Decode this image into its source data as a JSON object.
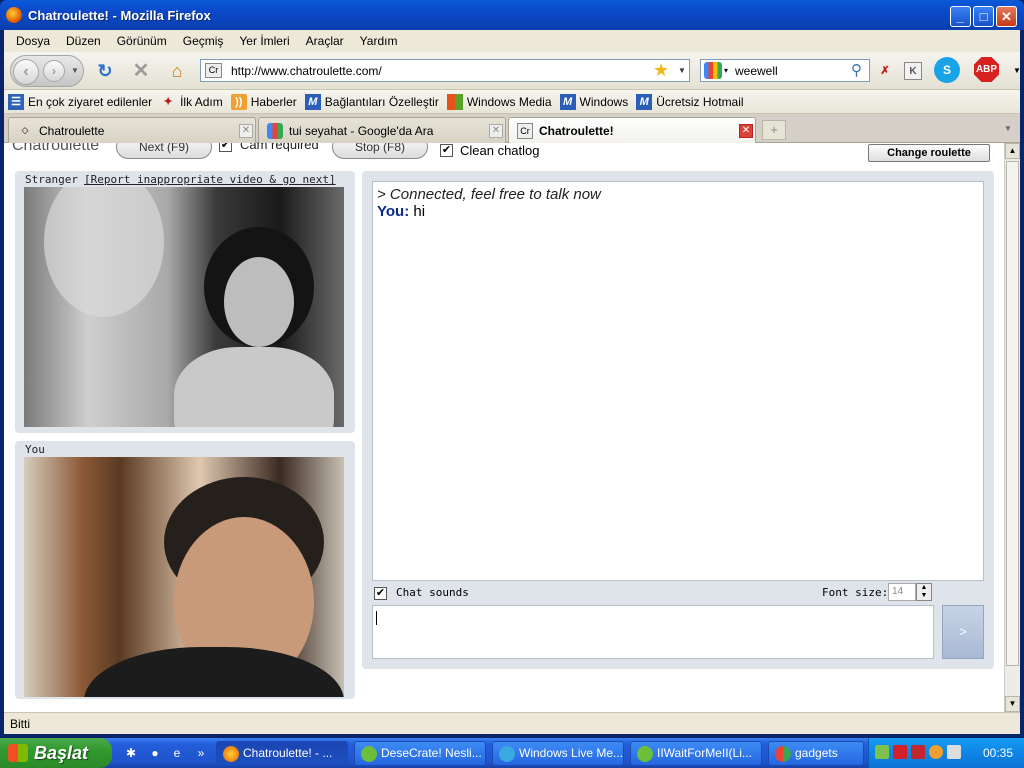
{
  "window": {
    "title": "Chatroulette! - Mozilla Firefox",
    "minimize": "_",
    "maximize": "□",
    "close": "✕"
  },
  "menu": [
    "Dosya",
    "Düzen",
    "Görünüm",
    "Geçmiş",
    "Yer İmleri",
    "Araçlar",
    "Yardım"
  ],
  "nav": {
    "url": "http://www.chatroulette.com/",
    "favicon": "Cr",
    "search_value": "weewell",
    "addon_abp": "ABP",
    "addon_skype": "S",
    "addon_k": "K"
  },
  "bookmarks": [
    {
      "label": "En çok ziyaret edilenler",
      "icon": "most-visited-icon"
    },
    {
      "label": "İlk Adım",
      "icon": "firefox-start-icon"
    },
    {
      "label": "Haberler",
      "icon": "rss-icon"
    },
    {
      "label": "Bağlantıları Özelleştir",
      "icon": "msn-icon"
    },
    {
      "label": "Windows Media",
      "icon": "windows-icon"
    },
    {
      "label": "Windows",
      "icon": "msn-icon"
    },
    {
      "label": "Ücretsiz Hotmail",
      "icon": "msn-icon"
    }
  ],
  "tabs": [
    {
      "label": "Chatroulette",
      "favicon": "cr-diamond-icon",
      "active": false
    },
    {
      "label": "tui seyahat - Google'da Ara",
      "favicon": "google-icon",
      "active": false
    },
    {
      "label": "Chatroulette!",
      "favicon": "Cr",
      "active": true
    }
  ],
  "page": {
    "brand": "Chatroulette",
    "next_label": "Next (F9)",
    "cam_required_label": "Cam required",
    "stop_label": "Stop (F8)",
    "clean_chatlog_label": "Clean chatlog",
    "change_roulette_label": "Change roulette",
    "stranger_label": "Stranger",
    "report_link": "[Report inappropriate video & go next]",
    "you_label": "You",
    "chat_messages": [
      {
        "type": "system",
        "text": "> Connected, feel free to talk now"
      },
      {
        "type": "you",
        "who": "You:",
        "text": "hi"
      }
    ],
    "chat_sounds_label": "Chat sounds",
    "font_size_label": "Font size:",
    "font_size_value": "14",
    "send_label": ">"
  },
  "status": {
    "text": "Bitti"
  },
  "taskbar": {
    "start_label": "Başlat",
    "more_label": "»",
    "tasks": [
      {
        "label": "Chatroulette! - ...",
        "active": true
      },
      {
        "label": "DeseCrate! Nesli...",
        "active": false
      },
      {
        "label": "Windows Live Me...",
        "active": false
      },
      {
        "label": "IIWaitForMeII(Li...",
        "active": false
      },
      {
        "label": "gadgets",
        "active": false
      }
    ],
    "clock": "00:35"
  },
  "colors": {
    "chat_you": "#0a2a8a",
    "close_red": "#c4391a",
    "panel_bg": "#dfe3ea"
  }
}
